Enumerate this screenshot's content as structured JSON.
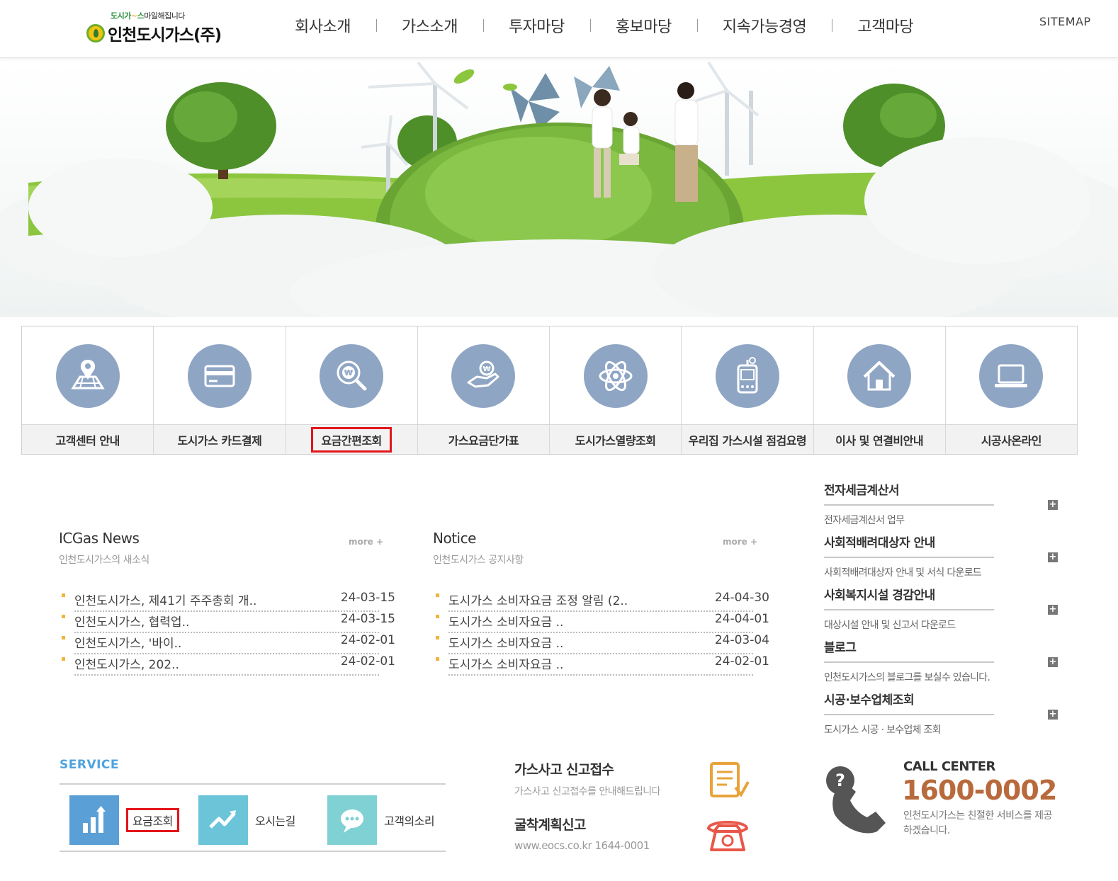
{
  "header": {
    "logo_slogan_green": "도시가",
    "logo_slogan_green2": "스",
    "logo_slogan_dark": "마일해집니다",
    "logo_name": "인천도시가스(주)",
    "nav": [
      "회사소개",
      "가스소개",
      "투자마당",
      "홍보마당",
      "지속가능경영",
      "고객마당"
    ],
    "sitemap": "SITEMAP"
  },
  "quick_menu": [
    {
      "label": "고객센터 안내",
      "icon": "map-pin-icon"
    },
    {
      "label": "도시가스 카드결제",
      "icon": "credit-card-icon"
    },
    {
      "label": "요금간편조회",
      "icon": "search-won-icon",
      "highlighted": true
    },
    {
      "label": "가스요금단가표",
      "icon": "hand-coin-icon"
    },
    {
      "label": "도시가스열량조회",
      "icon": "atom-icon"
    },
    {
      "label": "우리집 가스시설 점검요령",
      "icon": "gas-meter-icon"
    },
    {
      "label": "이사 및 연결비안내",
      "icon": "house-icon"
    },
    {
      "label": "시공사온라인",
      "icon": "laptop-icon"
    }
  ],
  "news": {
    "title": "ICGas News",
    "subtitle": "인천도시가스의 새소식",
    "more": "more +",
    "items": [
      {
        "text": "인천도시가스, 제41기 주주총회 개..",
        "date": "24-03-15"
      },
      {
        "text": "인천도시가스, 협력업..",
        "date": "24-03-15"
      },
      {
        "text": "인천도시가스, '바이..",
        "date": "24-02-01"
      },
      {
        "text": "인천도시가스, 202..",
        "date": "24-02-01"
      }
    ]
  },
  "notice": {
    "title": "Notice",
    "subtitle": "인천도시가스 공지사항",
    "more": "more +",
    "items": [
      {
        "text": "도시가스 소비자요금 조정 알림 (2..",
        "date": "24-04-30"
      },
      {
        "text": "도시가스 소비자요금 ..",
        "date": "24-04-01"
      },
      {
        "text": "도시가스 소비자요금 ..",
        "date": "24-03-04"
      },
      {
        "text": "도시가스 소비자요금 ..",
        "date": "24-02-01"
      }
    ]
  },
  "side_links": [
    {
      "title": "전자세금계산서",
      "desc": "전자세금계산서 업무"
    },
    {
      "title": "사회적배려대상자 안내",
      "desc": "사회적배려대상자 안내 및 서식 다운로드"
    },
    {
      "title": "사회복지시설 경감안내",
      "desc": "대상시설 안내 및 신고서 다운로드"
    },
    {
      "title": "블로그",
      "desc": "인천도시가스의 블로그를 보실수 있습니다."
    },
    {
      "title": "시공·보수업체조회",
      "desc": "도시가스 시공 · 보수업체 조회"
    }
  ],
  "service": {
    "title": "SERVICE",
    "items": [
      {
        "label": "요금조회",
        "icon": "bar-chart-icon",
        "highlighted": true
      },
      {
        "label": "오시는길",
        "icon": "trend-line-icon"
      },
      {
        "label": "고객의소리",
        "icon": "speech-bubble-icon"
      }
    ]
  },
  "report": {
    "accident_title": "가스사고 신고접수",
    "accident_sub": "가스사고 신고접수를 안내해드립니다",
    "dig_title": "굴착계획신고",
    "dig_sub": "www.eocs.co.kr 1644-0001"
  },
  "call_center": {
    "label": "CALL CENTER",
    "number": "1600-0002",
    "desc": "인천도시가스는 친절한 서비스를 제공하겠습니다."
  },
  "colors": {
    "icon_circle": "#8fa5c4",
    "highlight": "#e2161b",
    "service_title": "#4fa3e0",
    "call_number": "#b86a3c"
  }
}
